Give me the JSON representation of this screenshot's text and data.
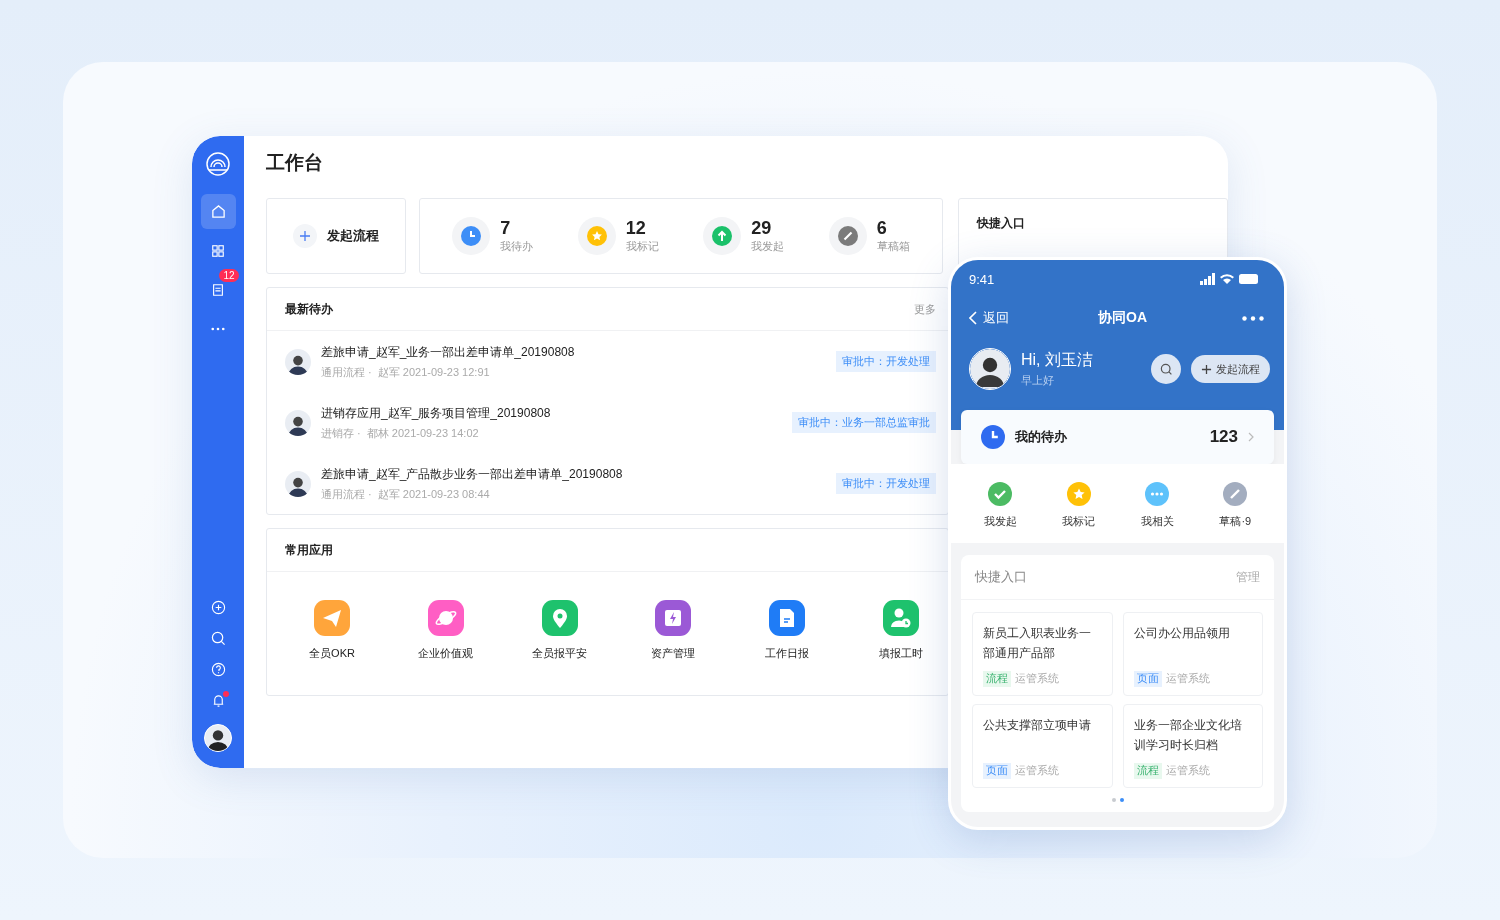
{
  "sidebar": {
    "nav": [
      {
        "kind": "home",
        "selected": true
      },
      {
        "kind": "apps",
        "selected": false
      },
      {
        "kind": "list",
        "selected": false,
        "badge": "12"
      },
      {
        "kind": "more",
        "selected": false
      }
    ],
    "tools": [
      {
        "kind": "add",
        "dot": false
      },
      {
        "kind": "search",
        "dot": false
      },
      {
        "kind": "help",
        "dot": false
      },
      {
        "kind": "bell",
        "dot": true
      }
    ]
  },
  "workbench": {
    "title": "工作台",
    "new_flow": "发起流程",
    "stats": [
      {
        "kind": "clock",
        "value": "7",
        "label": "我待办",
        "color": "#3d8ef7"
      },
      {
        "kind": "star",
        "value": "12",
        "label": "我标记",
        "color": "#ffc107"
      },
      {
        "kind": "up",
        "value": "29",
        "label": "我发起",
        "color": "#1bc16a"
      },
      {
        "kind": "pen",
        "value": "6",
        "label": "草稿箱",
        "color": "#7b7b7b"
      }
    ],
    "quick_entry": {
      "title": "快捷入口"
    },
    "todo": {
      "title": "最新待办",
      "more": "更多",
      "items": [
        {
          "title": "差旅申请_赵军_业务一部出差申请单_20190808",
          "category": "通用流程 ·",
          "meta": "赵军 2021-09-23 12:91",
          "status": "审批中：开发处理"
        },
        {
          "title": "进销存应用_赵军_服务项目管理_20190808",
          "category": "进销存 ·",
          "meta": "都林 2021-09-23 14:02",
          "status": "审批中：业务一部总监审批"
        },
        {
          "title": "差旅申请_赵军_产品散步业务一部出差申请单_20190808",
          "category": "通用流程 ·",
          "meta": "赵军 2021-09-23 08:44",
          "status": "审批中：开发处理"
        }
      ]
    },
    "apps": {
      "title": "常用应用",
      "items": [
        {
          "kind": "plane",
          "label": "全员OKR",
          "color": "#ffa53b"
        },
        {
          "kind": "planet",
          "label": "企业价值观",
          "color": "#ff5ec4"
        },
        {
          "kind": "pin",
          "label": "全员报平安",
          "color": "#1ec26d"
        },
        {
          "kind": "bolt",
          "label": "资产管理",
          "color": "#9b59d6"
        },
        {
          "kind": "doc",
          "label": "工作日报",
          "color": "#1f7cf6"
        },
        {
          "kind": "user-clock",
          "label": "填报工时",
          "color": "#1ec26d"
        }
      ]
    }
  },
  "phone": {
    "status_bar": {
      "time": "9:41"
    },
    "nav": {
      "back": "返回",
      "title": "协同OA"
    },
    "user": {
      "greeting": "Hi, 刘玉洁",
      "subtitle": "早上好"
    },
    "new_flow": "发起流程",
    "pending": {
      "label": "我的待办",
      "count": "123"
    },
    "shortcuts": [
      {
        "kind": "check",
        "label": "我发起",
        "color": "#4cbb63"
      },
      {
        "kind": "star",
        "label": "我标记",
        "color": "#ffc107"
      },
      {
        "kind": "dots",
        "label": "我相关",
        "color": "#5ec2fb"
      },
      {
        "kind": "pen",
        "label": "草稿·9",
        "color": "#a3adbf"
      }
    ],
    "quick": {
      "title": "快捷入口",
      "manage": "管理",
      "cards": [
        {
          "title": "新员工入职表业务一部通用产品部",
          "tag": "流程",
          "kind": "flow",
          "system": "运管系统"
        },
        {
          "title": "公司办公用品领用",
          "tag": "页面",
          "kind": "page",
          "system": "运管系统"
        },
        {
          "title": "公共支撑部立项申请",
          "tag": "页面",
          "kind": "page",
          "system": "运管系统"
        },
        {
          "title": "业务一部企业文化培训学习时长归档",
          "tag": "流程",
          "kind": "flow",
          "system": "运管系统"
        }
      ],
      "pages": [
        {
          "selected": false
        },
        {
          "selected": true
        }
      ]
    }
  }
}
